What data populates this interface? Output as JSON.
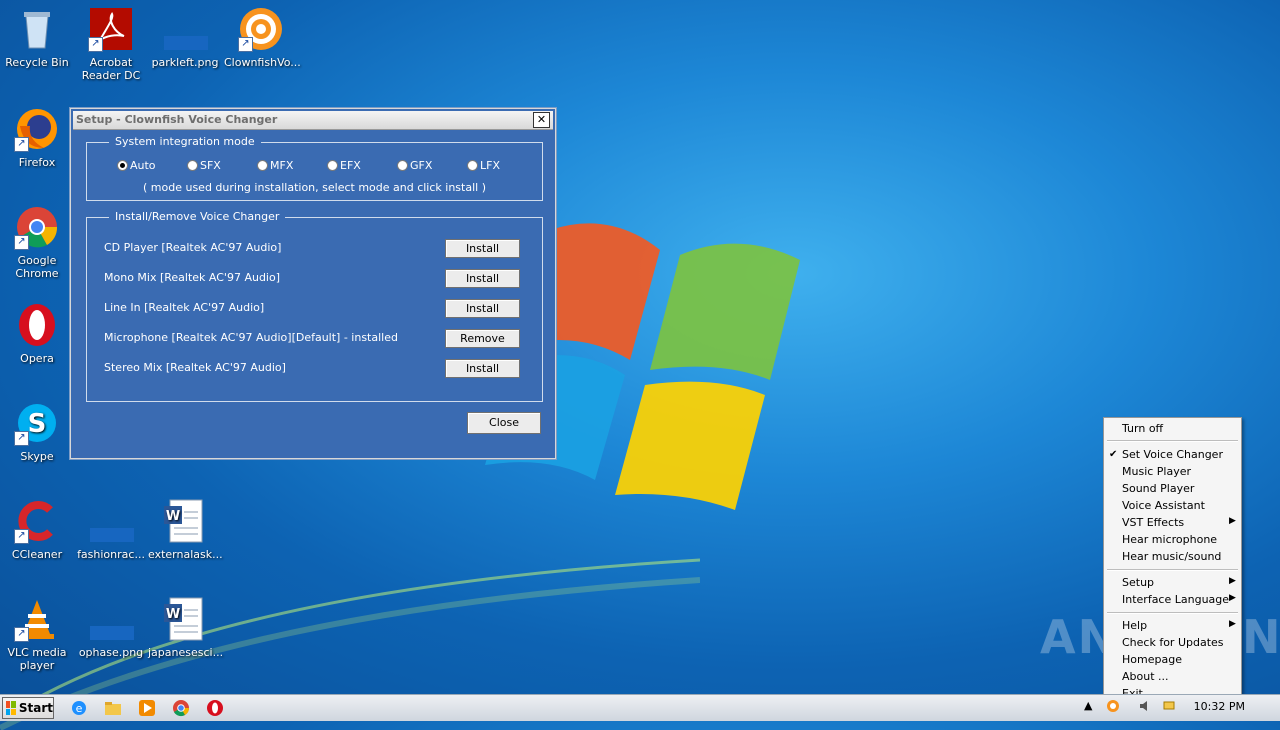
{
  "desktop": {
    "icons": [
      {
        "label": "Recycle Bin",
        "icon": "recycle-bin-icon"
      },
      {
        "label": "Acrobat Reader DC",
        "icon": "acrobat-icon"
      },
      {
        "label": "parkleft.png",
        "icon": "image-file-icon"
      },
      {
        "label": "ClownfishVo...",
        "icon": "clownfish-icon"
      },
      {
        "label": "Firefox",
        "icon": "firefox-icon"
      },
      {
        "label": "Google Chrome",
        "icon": "chrome-icon"
      },
      {
        "label": "Opera",
        "icon": "opera-icon"
      },
      {
        "label": "Skype",
        "icon": "skype-icon"
      },
      {
        "label": "CCleaner",
        "icon": "ccleaner-icon"
      },
      {
        "label": "fashionrac...",
        "icon": "image-file-icon"
      },
      {
        "label": "externalask...",
        "icon": "word-document-icon"
      },
      {
        "label": "VLC media player",
        "icon": "vlc-icon"
      },
      {
        "label": "ophase.png",
        "icon": "image-file-icon"
      },
      {
        "label": "japanesesci...",
        "icon": "word-document-icon"
      }
    ]
  },
  "dialog": {
    "title": "Setup - Clownfish Voice Changer",
    "close_glyph": "✕",
    "integration": {
      "legend": "System integration mode",
      "modes": [
        "Auto",
        "SFX",
        "MFX",
        "EFX",
        "GFX",
        "LFX"
      ],
      "selected": "Auto",
      "note": "( mode used during installation, select mode and click install )"
    },
    "install": {
      "legend": "Install/Remove Voice Changer",
      "devices": [
        {
          "label": "CD Player [Realtek AC'97 Audio]",
          "action": "Install"
        },
        {
          "label": "Mono Mix [Realtek AC'97 Audio]",
          "action": "Install"
        },
        {
          "label": "Line In [Realtek AC'97 Audio]",
          "action": "Install"
        },
        {
          "label": "Microphone [Realtek AC'97 Audio][Default] - installed",
          "action": "Remove"
        },
        {
          "label": "Stereo Mix [Realtek AC'97 Audio]",
          "action": "Install"
        }
      ]
    },
    "close_label": "Close"
  },
  "context_menu": {
    "items": [
      {
        "label": "Turn off"
      },
      {
        "label": "Set Voice Changer",
        "checked": true
      },
      {
        "label": "Music Player"
      },
      {
        "label": "Sound Player"
      },
      {
        "label": "Voice Assistant"
      },
      {
        "label": "VST Effects",
        "submenu": true
      },
      {
        "label": "Hear microphone"
      },
      {
        "label": "Hear music/sound"
      },
      {
        "label": "Setup",
        "submenu": true
      },
      {
        "label": "Interface Language",
        "submenu": true
      },
      {
        "label": "Help",
        "submenu": true
      },
      {
        "label": "Check for Updates"
      },
      {
        "label": "Homepage"
      },
      {
        "label": "About ..."
      },
      {
        "label": "Exit"
      }
    ]
  },
  "watermark": "ANY.RUN",
  "taskbar": {
    "start_label": "Start",
    "pinned": [
      "internet-explorer-icon",
      "file-explorer-icon",
      "media-player-icon",
      "chrome-icon",
      "opera-icon"
    ],
    "clock": "10:32 PM",
    "tray_arrow": "▲"
  },
  "colors": {
    "dialog_bg": "#3a6bb2",
    "desktop": "#1d87d6"
  }
}
